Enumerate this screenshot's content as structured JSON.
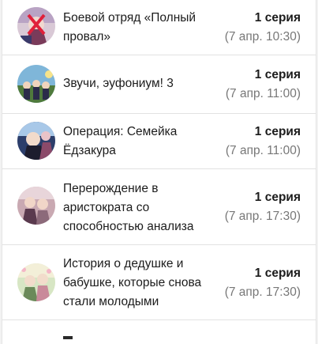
{
  "schedule": {
    "items": [
      {
        "title": "Боевой отряд «Полный провал»",
        "episode": "1 серия",
        "time": "(7 апр. 10:30)",
        "avatar_icon": "anime-poster-icon"
      },
      {
        "title": "Звучи, эуфониум! 3",
        "episode": "1 серия",
        "time": "(7 апр. 11:00)",
        "avatar_icon": "anime-poster-icon"
      },
      {
        "title": "Операция: Семейка Ёдзакура",
        "episode": "1 серия",
        "time": "(7 апр. 11:00)",
        "avatar_icon": "anime-poster-icon"
      },
      {
        "title": "Перерождение в аристократа со способностью анализа",
        "episode": "1 серия",
        "time": "(7 апр. 17:30)",
        "avatar_icon": "anime-poster-icon"
      },
      {
        "title": "История о дедушке и бабушке, которые снова стали молодыми",
        "episode": "1 серия",
        "time": "(7 апр. 17:30)",
        "avatar_icon": "anime-poster-icon"
      }
    ]
  }
}
